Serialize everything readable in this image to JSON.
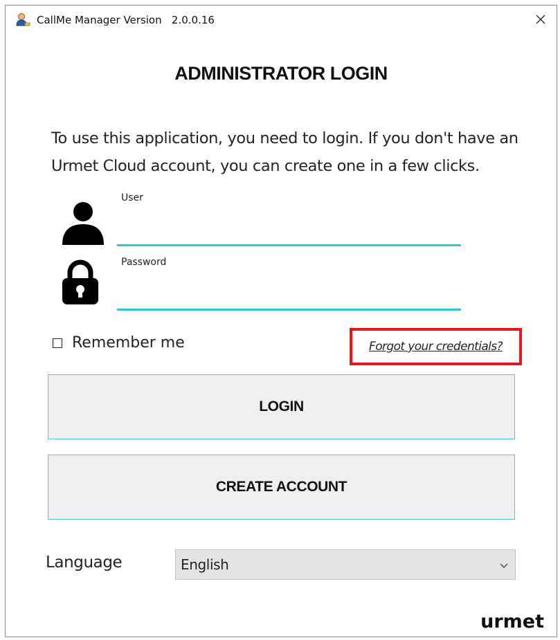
{
  "window": {
    "title": "CallMe Manager Version   2.0.0.16",
    "app_icon": "user-manager-icon",
    "close_glyph": "✕"
  },
  "login": {
    "heading": "ADMINISTRATOR LOGIN",
    "intro": "To use this application, you need to login. If you don't have an Urmet Cloud account, you can create one in a few clicks.",
    "user_label": "User",
    "user_value": "",
    "password_label": "Password",
    "password_value": "",
    "user_icon": "person-icon",
    "password_icon": "lock-icon",
    "remember_label": "Remember me",
    "remember_checked": false,
    "forgot_label": "Forgot your credentials?",
    "login_button": "LOGIN",
    "create_button": "CREATE ACCOUNT"
  },
  "language": {
    "label": "Language",
    "selected": "English"
  },
  "brand": {
    "logo_text": "urmet"
  },
  "colors": {
    "accent_underline": "#2ec4dc",
    "button_border": "#49c6dd",
    "button_bg": "#efefef",
    "highlight_box": "#e8141b",
    "select_bg": "#e3e3e3"
  }
}
